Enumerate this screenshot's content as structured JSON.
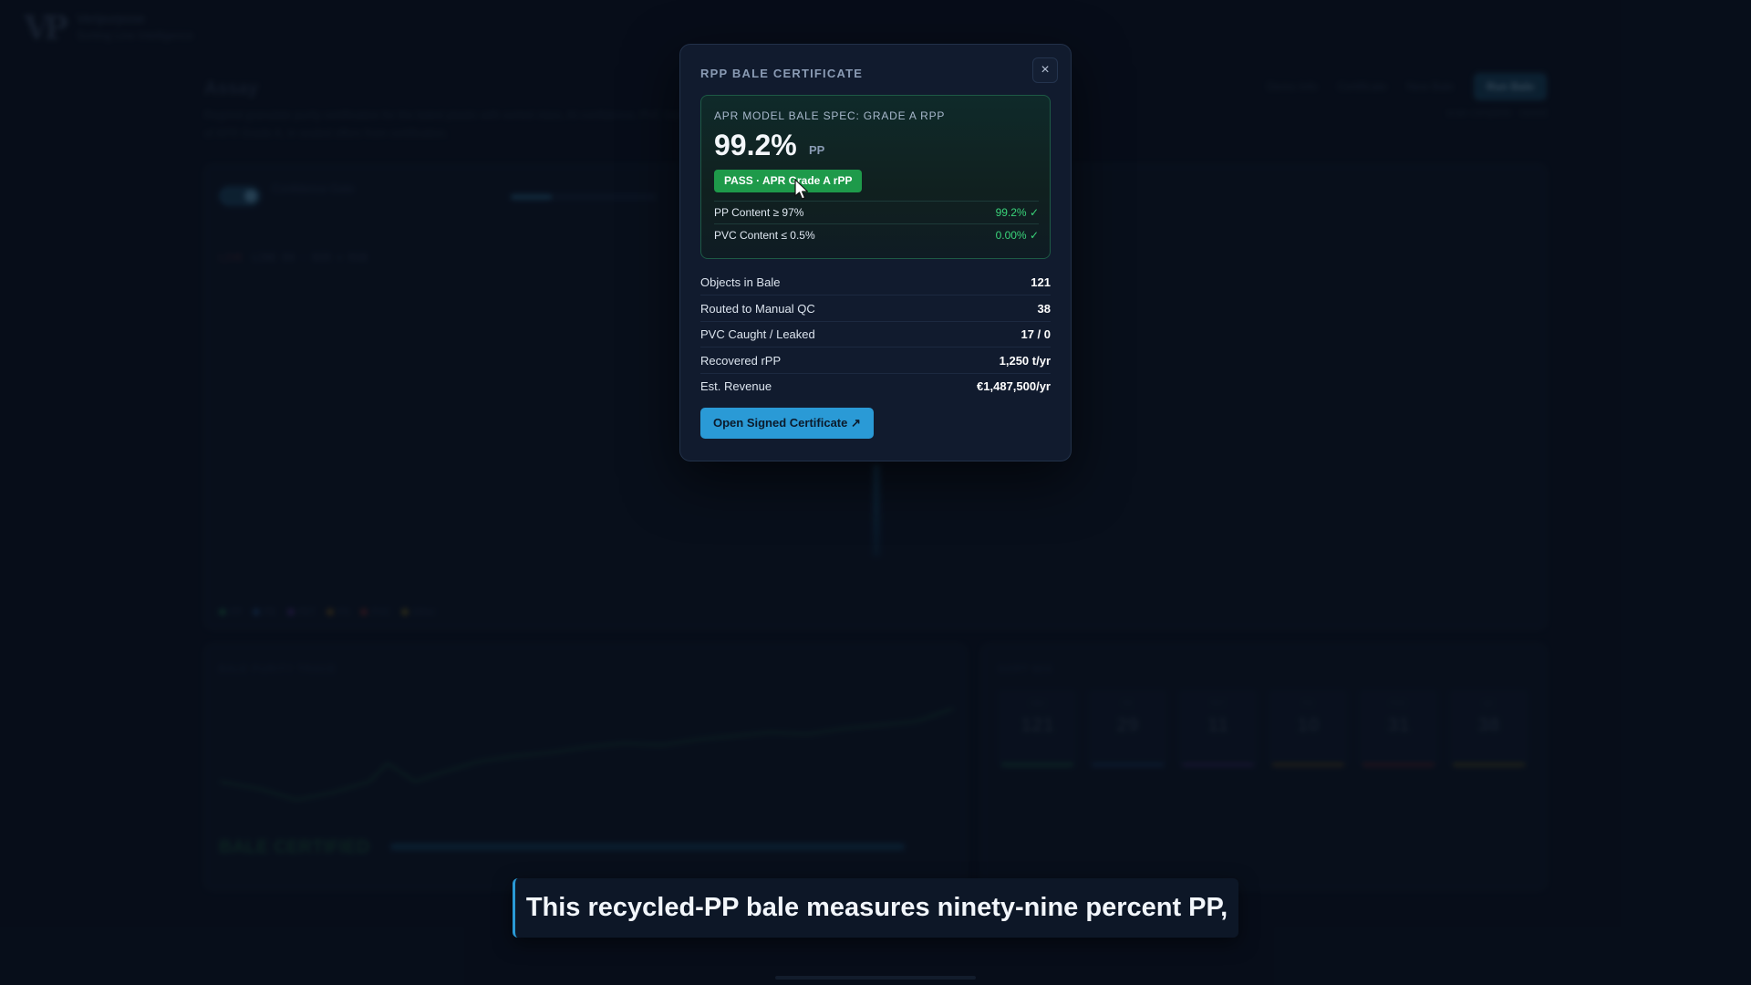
{
  "background": {
    "brand_name": "Veripurpose",
    "brand_sub": "Sorting Line Intelligence",
    "page_title": "Assay",
    "page_desc": "Regrind granulate purity certification for the baled plastic with sorted class, AI-confidence, PVC leak of APR Grade A, in sealed offers from certification.",
    "nav": [
      "Demo Info",
      "Certificate",
      "New Bale",
      "Run Bale"
    ],
    "meta": "scan complete · saved",
    "conf_label": "Confidence Gate",
    "line_live": "LIVE",
    "line_info": "LINE 04 · NIR + RGB",
    "legend": [
      "PP",
      "PE",
      "PET",
      "PS",
      "PVC",
      "Other"
    ],
    "chart_title": "BALE PURITY TRACE",
    "mix_title": "SORT MIX",
    "status": "BALE CERTIFIED",
    "tiles": [
      {
        "label": "OBJ",
        "value": "121",
        "color": "#1e6b48"
      },
      {
        "label": "PE",
        "value": "29",
        "color": "#224a7a"
      },
      {
        "label": "PET",
        "value": "11",
        "color": "#4a2f7a"
      },
      {
        "label": "PS",
        "value": "10",
        "color": "#7a5a1e"
      },
      {
        "label": "PVC",
        "value": "31",
        "color": "#7a2a2a"
      },
      {
        "label": "QC",
        "value": "38",
        "color": "#7a6a1e"
      }
    ]
  },
  "modal": {
    "title": "RPP BALE CERTIFICATE",
    "close_label": "×",
    "spec": {
      "label": "APR MODEL BALE SPEC: GRADE A RPP",
      "value": "99.2%",
      "unit": "PP",
      "badge": "PASS · APR Grade A rPP",
      "criteria": [
        {
          "label": "PP Content ≥ 97%",
          "value": "99.2% ✓"
        },
        {
          "label": "PVC Content ≤ 0.5%",
          "value": "0.00% ✓"
        }
      ]
    },
    "stats": [
      {
        "label": "Objects in Bale",
        "value": "121"
      },
      {
        "label": "Routed to Manual QC",
        "value": "38"
      },
      {
        "label": "PVC Caught / Leaked",
        "value": "17 / 0"
      },
      {
        "label": "Recovered rPP",
        "value": "1,250 t/yr"
      },
      {
        "label": "Est. Revenue",
        "value": "€1,487,500/yr"
      }
    ],
    "cta": "Open Signed Certificate ↗"
  },
  "caption": "This recycled-PP bale measures ninety-nine percent PP,",
  "colors": {
    "accent": "#2a9ad6",
    "pass": "#1e9a4a",
    "check": "#3ad47a"
  }
}
